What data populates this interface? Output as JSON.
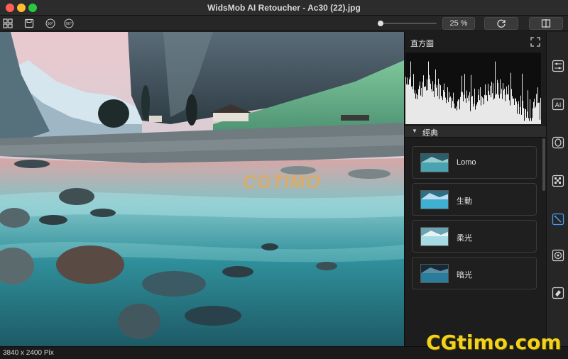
{
  "window": {
    "title": "WidsMob AI Retoucher - Ac30 (22).jpg"
  },
  "toolbar": {
    "grid_icon": "grid-icon",
    "save_icon": "save-icon",
    "rotate_left_label": "90°",
    "rotate_right_label": "90°",
    "zoom_level": "25 %",
    "zoom_fraction": 0.02
  },
  "panel": {
    "histogram_title": "直方圖",
    "section_label": "經典",
    "presets": [
      {
        "label": "Lomo"
      },
      {
        "label": "生動"
      },
      {
        "label": "柔光"
      },
      {
        "label": "暗光"
      }
    ]
  },
  "tools": [
    "adjust-icon",
    "ai-icon",
    "portrait-icon",
    "mosaic-icon",
    "magic-wand-icon",
    "aperture-icon",
    "eraser-icon"
  ],
  "overlay": {
    "watermark": "CGTIMO",
    "brand": "CGtimo.com"
  },
  "status": {
    "dimensions": "3840 x 2400 Pix"
  },
  "colors": {
    "accent": "#4a9ff5",
    "brand": "#f2d21a"
  }
}
